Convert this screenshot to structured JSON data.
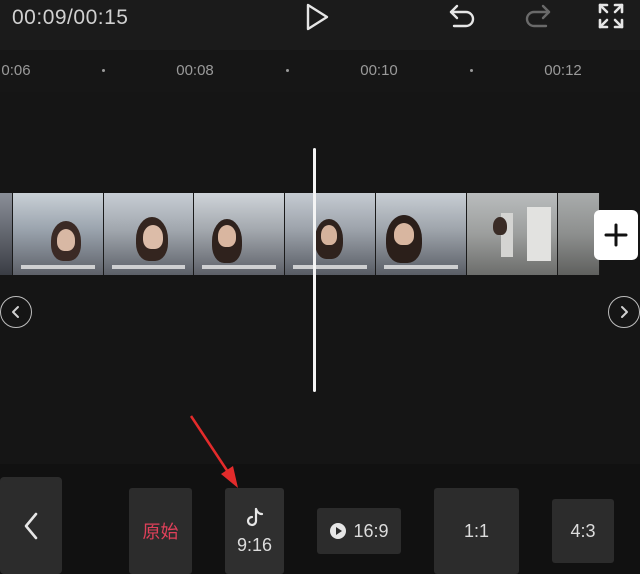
{
  "header": {
    "time_display": "00:09/00:15",
    "icons": [
      "play-icon",
      "undo-icon",
      "redo-icon",
      "fullscreen-icon"
    ]
  },
  "ruler": {
    "ticks": [
      "0:06",
      "00:08",
      "00:10",
      "00:12"
    ]
  },
  "timeline": {
    "add_clip_icon": "plus-icon",
    "nav_left_icon": "chevron-left-icon",
    "nav_right_icon": "chevron-right-icon"
  },
  "ratios": [
    {
      "label": "原始",
      "icon": null
    },
    {
      "label": "9:16",
      "icon": "tiktok-icon"
    },
    {
      "label": "16:9",
      "icon": "play-badge-icon"
    },
    {
      "label": "1:1",
      "icon": null
    },
    {
      "label": "4:3",
      "icon": null
    }
  ],
  "colors": {
    "accent_red": "#e0405a",
    "arrow_red": "#e32b2b",
    "background": "#161616"
  }
}
